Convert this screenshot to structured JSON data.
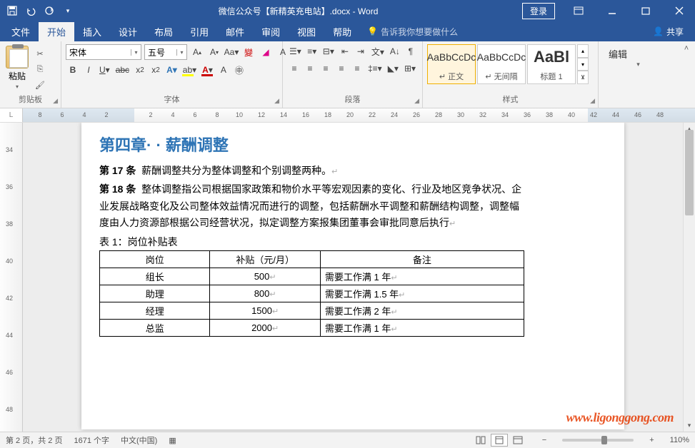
{
  "titlebar": {
    "title": "微信公众号【新精英充电站】.docx - Word",
    "login": "登录"
  },
  "menu": {
    "file": "文件",
    "home": "开始",
    "insert": "插入",
    "design": "设计",
    "layout": "布局",
    "references": "引用",
    "mailings": "邮件",
    "review": "审阅",
    "view": "视图",
    "help": "帮助",
    "tellme": "告诉我你想要做什么",
    "share": "共享"
  },
  "ribbon": {
    "clipboard": {
      "label": "剪贴板",
      "paste": "粘贴"
    },
    "font": {
      "label": "字体",
      "name": "宋体",
      "size": "五号"
    },
    "paragraph": {
      "label": "段落"
    },
    "styles": {
      "label": "样式",
      "items": [
        {
          "preview": "AaBbCcDc",
          "name": "↵ 正文"
        },
        {
          "preview": "AaBbCcDc",
          "name": "↵ 无间隔"
        },
        {
          "preview": "AaBl",
          "name": "标题 1"
        }
      ]
    },
    "editing": {
      "label": "编辑"
    }
  },
  "ruler": {
    "h": [
      "8",
      "6",
      "4",
      "2",
      "",
      "2",
      "4",
      "6",
      "8",
      "10",
      "12",
      "14",
      "16",
      "18",
      "20",
      "22",
      "24",
      "26",
      "28",
      "30",
      "32",
      "34",
      "36",
      "38",
      "40",
      "42",
      "44",
      "46",
      "48"
    ],
    "v": [
      "",
      "34",
      "",
      "36",
      "",
      "38",
      "",
      "40",
      "",
      "42",
      "",
      "44",
      "",
      "46",
      "",
      "48",
      ""
    ]
  },
  "document": {
    "chapter": "第四章· · 薪酬调整",
    "art17_label": "第 17 条",
    "art17_text": "薪酬调整共分为整体调整和个别调整两种。",
    "art18_label": "第 18 条",
    "art18_text": "整体调整指公司根据国家政策和物价水平等宏观因素的变化、行业及地区竞争状况、企业发展战略变化及公司整体效益情况而进行的调整，包括薪酬水平调整和薪酬结构调整，调整幅度由人力资源部根据公司经营状况，拟定调整方案报集团董事会审批同意后执行",
    "table_caption": "表 1：岗位补贴表",
    "table": {
      "headers": [
        "岗位",
        "补贴（元/月）",
        "备注"
      ],
      "rows": [
        [
          "组长",
          "500",
          "需要工作满 1 年"
        ],
        [
          "助理",
          "800",
          "需要工作满 1.5 年"
        ],
        [
          "经理",
          "1500",
          "需要工作满 2 年"
        ],
        [
          "总监",
          "2000",
          "需要工作满 1 年"
        ]
      ]
    }
  },
  "status": {
    "page": "第 2 页，共 2 页",
    "words": "1671 个字",
    "lang": "中文(中国)",
    "zoom": "110%"
  },
  "watermark": "www.ligonggong.com"
}
